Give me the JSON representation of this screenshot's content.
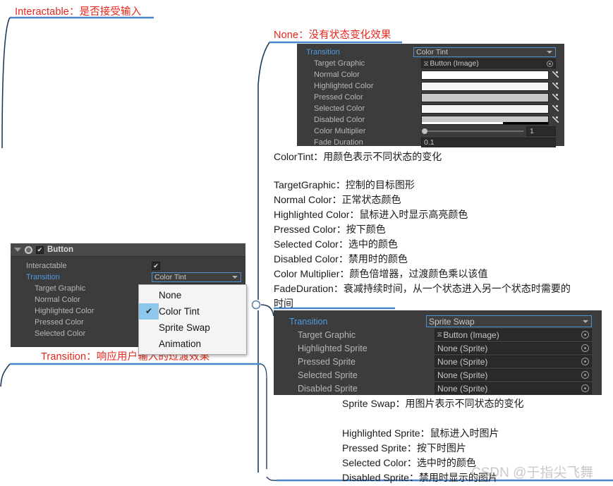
{
  "annotations": {
    "interactable": "Interactable：是否接受输入",
    "none": "None：没有状态变化效果",
    "transition": "Transition：响应用户输入的过渡效果"
  },
  "color_tint_panel": {
    "rows": [
      {
        "label": "Transition",
        "value": "Color Tint",
        "type": "popup"
      },
      {
        "label": "Target Graphic",
        "value": "Button (Image)",
        "type": "object"
      },
      {
        "label": "Normal Color",
        "value": "#FFFFFF",
        "type": "color"
      },
      {
        "label": "Highlighted Color",
        "value": "#F5F5F5",
        "type": "color"
      },
      {
        "label": "Pressed Color",
        "value": "#C8C8C8",
        "type": "color"
      },
      {
        "label": "Selected Color",
        "value": "#F5F5F5",
        "type": "color"
      },
      {
        "label": "Disabled Color",
        "value": "#C8C8C8",
        "type": "color-alpha"
      },
      {
        "label": "Color Multiplier",
        "value": "1",
        "type": "slider"
      },
      {
        "label": "Fade Duration",
        "value": "0.1",
        "type": "number"
      }
    ]
  },
  "color_tint_desc": {
    "title": "ColorTint：用颜色表示不同状态的变化",
    "lines": [
      "TargetGraphic：控制的目标图形",
      "Normal Color：正常状态颜色",
      "Highlighted Color：鼠标进入时显示高亮颜色",
      "Pressed Color：按下颜色",
      "Selected Color：选中的颜色",
      "Disabled Color：禁用时的颜色",
      "Color Multiplier：颜色倍增器，过渡颜色乘以该值",
      "FadeDuration：衰减持续时间，从一个状态进入另一个状态时需要的",
      "时间"
    ]
  },
  "button_panel": {
    "header": {
      "title": "Button",
      "enabled_check": "✔"
    },
    "rows": [
      {
        "label": "Interactable",
        "type": "checkbox",
        "value": "✔"
      },
      {
        "label": "Transition",
        "value": "Color Tint",
        "type": "popup"
      },
      {
        "label": "Target Graphic",
        "type": "hidden"
      },
      {
        "label": "Normal Color",
        "type": "hidden"
      },
      {
        "label": "Highlighted Color",
        "type": "hidden"
      },
      {
        "label": "Pressed Color",
        "type": "hidden"
      },
      {
        "label": "Selected Color",
        "type": "hidden"
      }
    ]
  },
  "transition_dropdown": {
    "items": [
      {
        "label": "None",
        "checked": false
      },
      {
        "label": "Color Tint",
        "checked": true
      },
      {
        "label": "Sprite Swap",
        "checked": false
      },
      {
        "label": "Animation",
        "checked": false
      }
    ],
    "check_glyph": "✔"
  },
  "sprite_swap_panel": {
    "rows": [
      {
        "label": "Transition",
        "value": "Sprite Swap",
        "type": "popup"
      },
      {
        "label": "Target Graphic",
        "value": "Button (Image)",
        "type": "object"
      },
      {
        "label": "Highlighted Sprite",
        "value": "None (Sprite)",
        "type": "object"
      },
      {
        "label": "Pressed Sprite",
        "value": "None (Sprite)",
        "type": "object"
      },
      {
        "label": "Selected Sprite",
        "value": "None (Sprite)",
        "type": "object"
      },
      {
        "label": "Disabled Sprite",
        "value": "None (Sprite)",
        "type": "object"
      }
    ]
  },
  "sprite_swap_desc": {
    "title": "Sprite Swap：用图片表示不同状态的变化",
    "lines": [
      "Highlighted Sprite：鼠标进入时图片",
      "Pressed Sprite：按下时图片",
      "Selected Color：选中时的颜色",
      "Disabled Sprite：禁用时显示的图片"
    ]
  },
  "watermark": "CSDN @于指尖飞舞",
  "colors": {
    "connector_blue": "#4a86c8",
    "connector_dark": "#1f3a5f",
    "annotation_red": "#e8261c",
    "panel_bg": "#3c3c3c",
    "field_bg": "#2a2a2a",
    "label_blue": "#4e9ae0"
  }
}
